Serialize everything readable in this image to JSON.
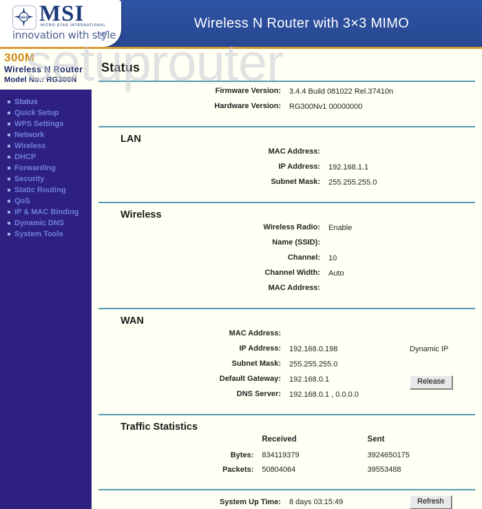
{
  "header": {
    "title": "Wireless N Router with 3×3 MIMO",
    "logo": {
      "brand": "MSI",
      "subtitle": "MICRO-STAR INTERNATIONAL",
      "tagline": "innovation with style"
    }
  },
  "watermark": "setuprouter",
  "sidebar": {
    "brand": {
      "speed": "300M",
      "product": "Wireless N Router",
      "model": "Model No.: RG300N"
    },
    "items": [
      {
        "label": "Status"
      },
      {
        "label": "Quick Setup"
      },
      {
        "label": "WPS Settings"
      },
      {
        "label": "Network"
      },
      {
        "label": "Wireless"
      },
      {
        "label": "DHCP"
      },
      {
        "label": "Forwarding"
      },
      {
        "label": "Security"
      },
      {
        "label": "Static Routing"
      },
      {
        "label": "QoS"
      },
      {
        "label": "IP & MAC Binding"
      },
      {
        "label": "Dynamic DNS"
      },
      {
        "label": "System Tools"
      }
    ]
  },
  "main": {
    "page_title": "Status",
    "version": {
      "rows": [
        {
          "label": "Firmware Version:",
          "value": "3.4.4 Build 081022 Rel.37410n"
        },
        {
          "label": "Hardware Version:",
          "value": "RG300Nv1 00000000"
        }
      ]
    },
    "lan": {
      "title": "LAN",
      "rows": [
        {
          "label": "MAC Address:",
          "value": ""
        },
        {
          "label": "IP Address:",
          "value": "192.168.1.1"
        },
        {
          "label": "Subnet Mask:",
          "value": "255.255.255.0"
        }
      ]
    },
    "wireless": {
      "title": "Wireless",
      "rows": [
        {
          "label": "Wireless Radio:",
          "value": "Enable"
        },
        {
          "label": "Name (SSID):",
          "value": ""
        },
        {
          "label": "Channel:",
          "value": "10"
        },
        {
          "label": "Channel Width:",
          "value": "Auto"
        },
        {
          "label": "MAC Address:",
          "value": ""
        }
      ]
    },
    "wan": {
      "title": "WAN",
      "rows": [
        {
          "label": "MAC Address:",
          "value": "",
          "extra": ""
        },
        {
          "label": "IP Address:",
          "value": "192.168.0.198",
          "extra": "Dynamic IP"
        },
        {
          "label": "Subnet Mask:",
          "value": "255.255.255.0",
          "extra": ""
        },
        {
          "label": "Default Gateway:",
          "value": "192.168.0.1",
          "extra": ""
        },
        {
          "label": "DNS Server:",
          "value": "192.168.0.1 , 0.0.0.0",
          "extra": ""
        }
      ],
      "release_button": "Release"
    },
    "traffic": {
      "title": "Traffic Statistics",
      "col_received": "Received",
      "col_sent": "Sent",
      "rows": [
        {
          "label": "Bytes:",
          "received": "834119379",
          "sent": "3924650175"
        },
        {
          "label": "Packets:",
          "received": "50804064",
          "sent": "39553488"
        }
      ]
    },
    "footer": {
      "uptime_label": "System Up Time:",
      "uptime_value": "8 days 03:15:49",
      "refresh_button": "Refresh"
    }
  },
  "colors": {
    "header_blue": "#2c52a0",
    "sidebar_indigo": "#2e2080",
    "accent_orange": "#d18a1c",
    "divider_teal": "#4f9bb0",
    "content_bg": "#fffff4"
  }
}
